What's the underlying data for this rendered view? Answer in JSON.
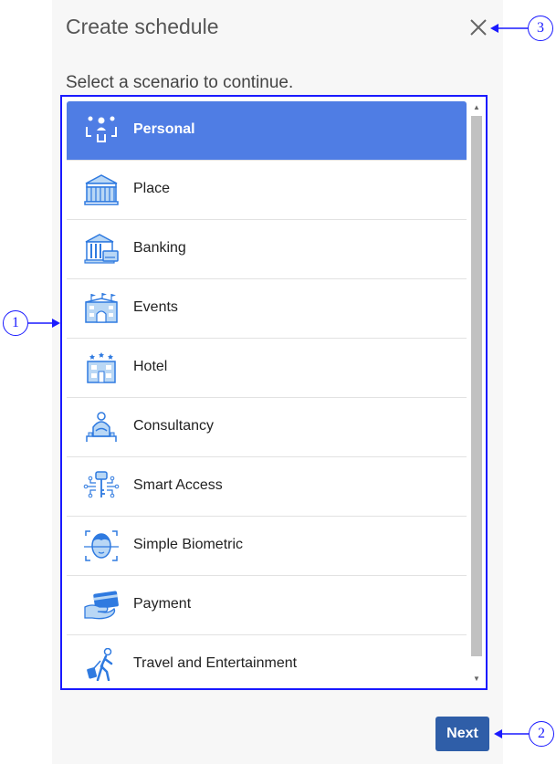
{
  "dialog": {
    "title": "Create schedule",
    "subtitle": "Select a scenario to continue.",
    "close_icon": "close-icon",
    "next_label": "Next"
  },
  "scenarios": [
    {
      "label": "Personal",
      "icon": "people-icon",
      "selected": true
    },
    {
      "label": "Place",
      "icon": "building-columns-icon",
      "selected": false
    },
    {
      "label": "Banking",
      "icon": "bank-icon",
      "selected": false
    },
    {
      "label": "Events",
      "icon": "event-venue-icon",
      "selected": false
    },
    {
      "label": "Hotel",
      "icon": "hotel-icon",
      "selected": false
    },
    {
      "label": "Consultancy",
      "icon": "consultant-icon",
      "selected": false
    },
    {
      "label": "Smart Access",
      "icon": "smart-key-icon",
      "selected": false
    },
    {
      "label": "Simple Biometric",
      "icon": "face-scan-icon",
      "selected": false
    },
    {
      "label": "Payment",
      "icon": "card-payment-icon",
      "selected": false
    },
    {
      "label": "Travel and Entertainment",
      "icon": "traveler-icon",
      "selected": false
    }
  ],
  "callouts": [
    "1",
    "2",
    "3"
  ],
  "colors": {
    "selected_bg": "#4f7de4",
    "icon_blue": "#2f7ae0",
    "icon_fill": "#b9d7f5",
    "next_bg": "#2f5ea8",
    "callout": "#1a1aff"
  }
}
